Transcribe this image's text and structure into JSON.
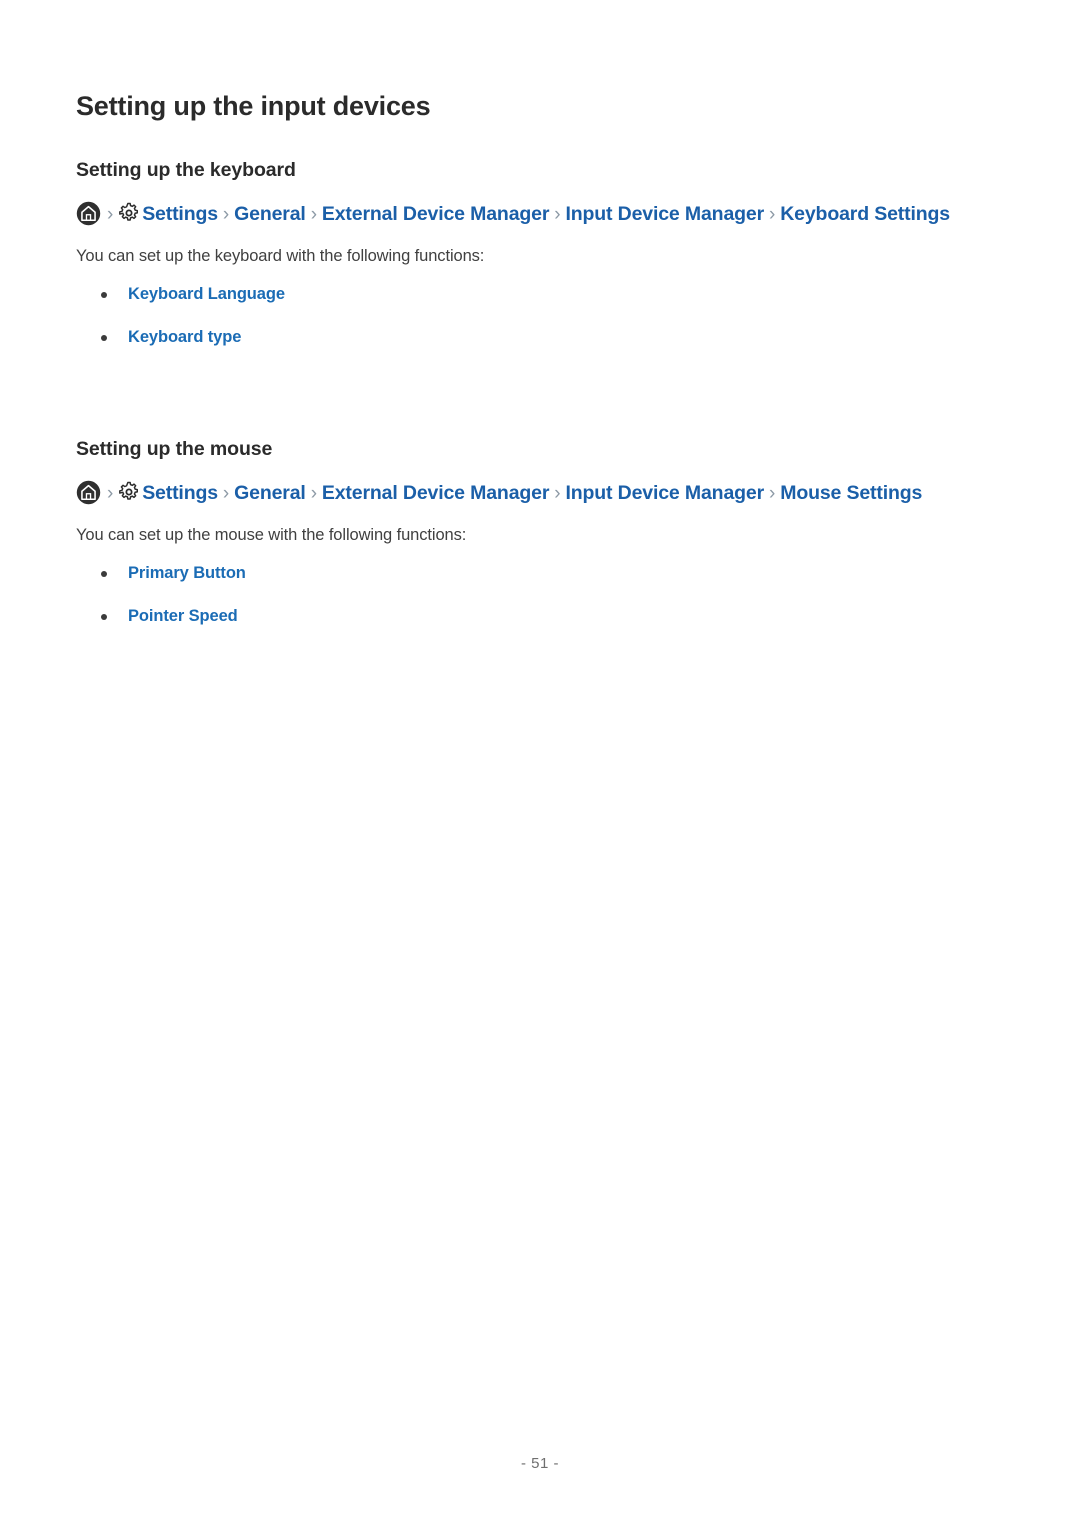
{
  "document": {
    "page_title": "Setting up the input devices",
    "page_number": "- 51 -"
  },
  "colors": {
    "link_blue": "#1B5FA8",
    "bullet_link_blue": "#1B6CB5",
    "separator_gray": "#8D9AA6",
    "heading_dark": "#2B2B2B",
    "body_gray": "#404040",
    "home_icon_circle": "#2F2F2F"
  },
  "sections": [
    {
      "id": "keyboard",
      "title": "Setting up the keyboard",
      "breadcrumb": {
        "home_icon": "home-icon",
        "gear_icon": "gear-icon",
        "separator": "›",
        "crumbs": [
          "Settings",
          "General",
          "External Device Manager",
          "Input Device Manager",
          "Keyboard Settings"
        ]
      },
      "intro": "You can set up the keyboard with the following functions:",
      "bullets": [
        "Keyboard Language",
        "Keyboard type"
      ]
    },
    {
      "id": "mouse",
      "title": "Setting up the mouse",
      "breadcrumb": {
        "home_icon": "home-icon",
        "gear_icon": "gear-icon",
        "separator": "›",
        "crumbs": [
          "Settings",
          "General",
          "External Device Manager",
          "Input Device Manager",
          "Mouse Settings"
        ]
      },
      "intro": "You can set up the mouse with the following functions:",
      "bullets": [
        "Primary Button",
        "Pointer Speed"
      ]
    }
  ]
}
